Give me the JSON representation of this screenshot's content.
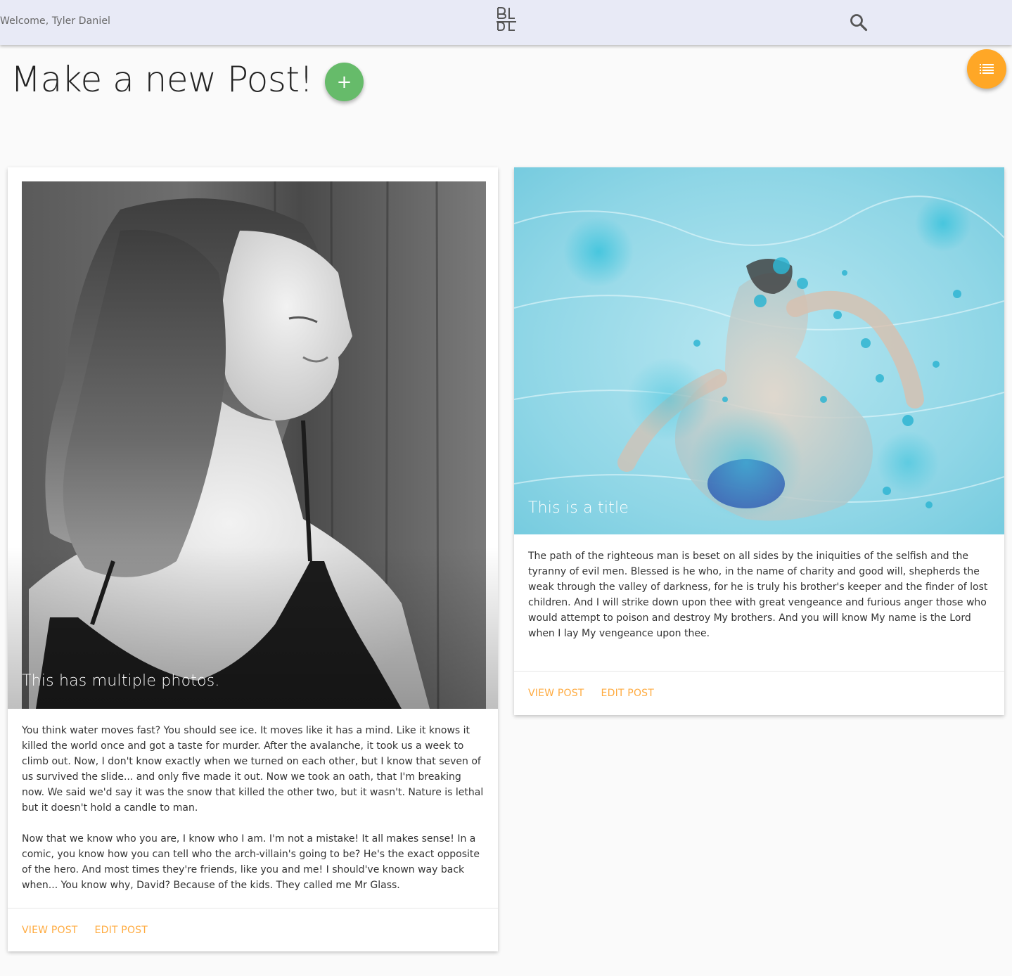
{
  "navbar": {
    "welcome_text": "Welcome, Tyler Daniel",
    "logo_icon": "blog-logo-icon",
    "search_icon": "search-icon"
  },
  "fab_list": {
    "icon": "list-icon",
    "color": "#ffa726"
  },
  "header": {
    "title": "Make a new Post!",
    "add_button_label": "+",
    "add_button_color": "#66bb6a"
  },
  "posts": [
    {
      "title": "This has multiple photos.",
      "image": "grayscale-portrait-photo",
      "paragraphs": [
        "You think water moves fast? You should see ice. It moves like it has a mind. Like it knows it killed the world once and got a taste for murder. After the avalanche, it took us a week to climb out. Now, I don't know exactly when we turned on each other, but I know that seven of us survived the slide... and only five made it out. Now we took an oath, that I'm breaking now. We said we'd say it was the snow that killed the other two, but it wasn't. Nature is lethal but it doesn't hold a candle to man.",
        "Now that we know who you are, I know who I am. I'm not a mistake! It all makes sense! In a comic, you know how you can tell who the arch-villain's going to be? He's the exact opposite of the hero. And most times they're friends, like you and me! I should've known way back when... You know why, David? Because of the kids. They called me Mr Glass."
      ],
      "view_label": "VIEW POST",
      "edit_label": "EDIT POST"
    },
    {
      "title": "This is a title",
      "image": "underwater-swimmer-photo",
      "paragraphs": [
        "The path of the righteous man is beset on all sides by the iniquities of the selfish and the tyranny of evil men. Blessed is he who, in the name of charity and good will, shepherds the weak through the valley of darkness, for he is truly his brother's keeper and the finder of lost children. And I will strike down upon thee with great vengeance and furious anger those who would attempt to poison and destroy My brothers. And you will know My name is the Lord when I lay My vengeance upon thee."
      ],
      "view_label": "VIEW POST",
      "edit_label": "EDIT POST"
    }
  ],
  "colors": {
    "navbar_bg": "#e8eaf6",
    "action_link": "#ffab40",
    "page_bg": "#fafafa"
  }
}
